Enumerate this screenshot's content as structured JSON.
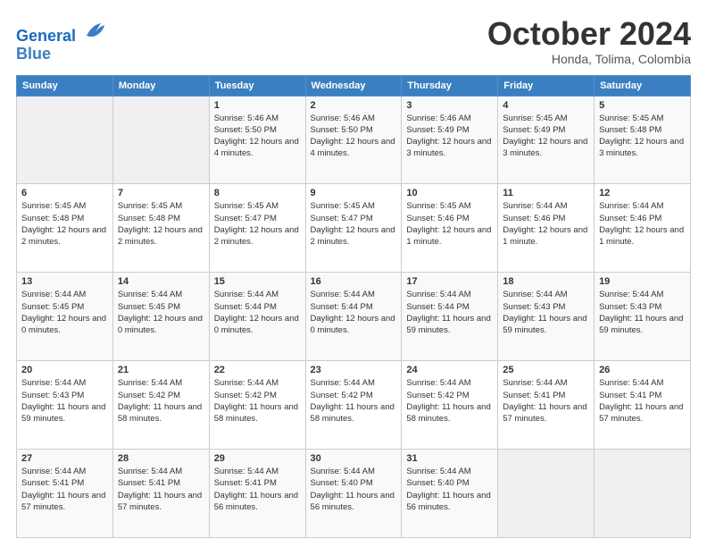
{
  "header": {
    "logo_line1": "General",
    "logo_line2": "Blue",
    "month": "October 2024",
    "location": "Honda, Tolima, Colombia"
  },
  "days_of_week": [
    "Sunday",
    "Monday",
    "Tuesday",
    "Wednesday",
    "Thursday",
    "Friday",
    "Saturday"
  ],
  "weeks": [
    [
      {
        "day": "",
        "info": ""
      },
      {
        "day": "",
        "info": ""
      },
      {
        "day": "1",
        "info": "Sunrise: 5:46 AM\nSunset: 5:50 PM\nDaylight: 12 hours and 4 minutes."
      },
      {
        "day": "2",
        "info": "Sunrise: 5:46 AM\nSunset: 5:50 PM\nDaylight: 12 hours and 4 minutes."
      },
      {
        "day": "3",
        "info": "Sunrise: 5:46 AM\nSunset: 5:49 PM\nDaylight: 12 hours and 3 minutes."
      },
      {
        "day": "4",
        "info": "Sunrise: 5:45 AM\nSunset: 5:49 PM\nDaylight: 12 hours and 3 minutes."
      },
      {
        "day": "5",
        "info": "Sunrise: 5:45 AM\nSunset: 5:48 PM\nDaylight: 12 hours and 3 minutes."
      }
    ],
    [
      {
        "day": "6",
        "info": "Sunrise: 5:45 AM\nSunset: 5:48 PM\nDaylight: 12 hours and 2 minutes."
      },
      {
        "day": "7",
        "info": "Sunrise: 5:45 AM\nSunset: 5:48 PM\nDaylight: 12 hours and 2 minutes."
      },
      {
        "day": "8",
        "info": "Sunrise: 5:45 AM\nSunset: 5:47 PM\nDaylight: 12 hours and 2 minutes."
      },
      {
        "day": "9",
        "info": "Sunrise: 5:45 AM\nSunset: 5:47 PM\nDaylight: 12 hours and 2 minutes."
      },
      {
        "day": "10",
        "info": "Sunrise: 5:45 AM\nSunset: 5:46 PM\nDaylight: 12 hours and 1 minute."
      },
      {
        "day": "11",
        "info": "Sunrise: 5:44 AM\nSunset: 5:46 PM\nDaylight: 12 hours and 1 minute."
      },
      {
        "day": "12",
        "info": "Sunrise: 5:44 AM\nSunset: 5:46 PM\nDaylight: 12 hours and 1 minute."
      }
    ],
    [
      {
        "day": "13",
        "info": "Sunrise: 5:44 AM\nSunset: 5:45 PM\nDaylight: 12 hours and 0 minutes."
      },
      {
        "day": "14",
        "info": "Sunrise: 5:44 AM\nSunset: 5:45 PM\nDaylight: 12 hours and 0 minutes."
      },
      {
        "day": "15",
        "info": "Sunrise: 5:44 AM\nSunset: 5:44 PM\nDaylight: 12 hours and 0 minutes."
      },
      {
        "day": "16",
        "info": "Sunrise: 5:44 AM\nSunset: 5:44 PM\nDaylight: 12 hours and 0 minutes."
      },
      {
        "day": "17",
        "info": "Sunrise: 5:44 AM\nSunset: 5:44 PM\nDaylight: 11 hours and 59 minutes."
      },
      {
        "day": "18",
        "info": "Sunrise: 5:44 AM\nSunset: 5:43 PM\nDaylight: 11 hours and 59 minutes."
      },
      {
        "day": "19",
        "info": "Sunrise: 5:44 AM\nSunset: 5:43 PM\nDaylight: 11 hours and 59 minutes."
      }
    ],
    [
      {
        "day": "20",
        "info": "Sunrise: 5:44 AM\nSunset: 5:43 PM\nDaylight: 11 hours and 59 minutes."
      },
      {
        "day": "21",
        "info": "Sunrise: 5:44 AM\nSunset: 5:42 PM\nDaylight: 11 hours and 58 minutes."
      },
      {
        "day": "22",
        "info": "Sunrise: 5:44 AM\nSunset: 5:42 PM\nDaylight: 11 hours and 58 minutes."
      },
      {
        "day": "23",
        "info": "Sunrise: 5:44 AM\nSunset: 5:42 PM\nDaylight: 11 hours and 58 minutes."
      },
      {
        "day": "24",
        "info": "Sunrise: 5:44 AM\nSunset: 5:42 PM\nDaylight: 11 hours and 58 minutes."
      },
      {
        "day": "25",
        "info": "Sunrise: 5:44 AM\nSunset: 5:41 PM\nDaylight: 11 hours and 57 minutes."
      },
      {
        "day": "26",
        "info": "Sunrise: 5:44 AM\nSunset: 5:41 PM\nDaylight: 11 hours and 57 minutes."
      }
    ],
    [
      {
        "day": "27",
        "info": "Sunrise: 5:44 AM\nSunset: 5:41 PM\nDaylight: 11 hours and 57 minutes."
      },
      {
        "day": "28",
        "info": "Sunrise: 5:44 AM\nSunset: 5:41 PM\nDaylight: 11 hours and 57 minutes."
      },
      {
        "day": "29",
        "info": "Sunrise: 5:44 AM\nSunset: 5:41 PM\nDaylight: 11 hours and 56 minutes."
      },
      {
        "day": "30",
        "info": "Sunrise: 5:44 AM\nSunset: 5:40 PM\nDaylight: 11 hours and 56 minutes."
      },
      {
        "day": "31",
        "info": "Sunrise: 5:44 AM\nSunset: 5:40 PM\nDaylight: 11 hours and 56 minutes."
      },
      {
        "day": "",
        "info": ""
      },
      {
        "day": "",
        "info": ""
      }
    ]
  ]
}
